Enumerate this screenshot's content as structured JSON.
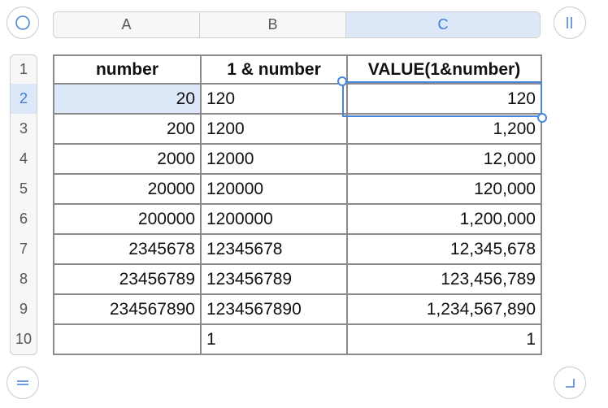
{
  "columns": [
    "A",
    "B",
    "C"
  ],
  "rows": [
    "1",
    "2",
    "3",
    "4",
    "5",
    "6",
    "7",
    "8",
    "9",
    "10"
  ],
  "selected_row": "2",
  "selected_column": "C",
  "table": {
    "header": [
      "number",
      "1 & number",
      "VALUE(1&number)"
    ],
    "data": [
      [
        "20",
        "120",
        "120"
      ],
      [
        "200",
        "1200",
        "1,200"
      ],
      [
        "2000",
        "12000",
        "12,000"
      ],
      [
        "20000",
        "120000",
        "120,000"
      ],
      [
        "200000",
        "1200000",
        "1,200,000"
      ],
      [
        "2345678",
        "12345678",
        "12,345,678"
      ],
      [
        "23456789",
        "123456789",
        "123,456,789"
      ],
      [
        "234567890",
        "1234567890",
        "1,234,567,890"
      ],
      [
        "",
        "1",
        "1"
      ]
    ]
  },
  "colors": {
    "accent": "#4a86d6",
    "selection_fill": "#dce8f8",
    "grid": "#8a8a8a"
  },
  "icons": {
    "top_left": "circle-icon",
    "top_right": "column-freeze-icon",
    "bottom_left": "row-freeze-icon",
    "bottom_right": "corner-resize-icon"
  }
}
